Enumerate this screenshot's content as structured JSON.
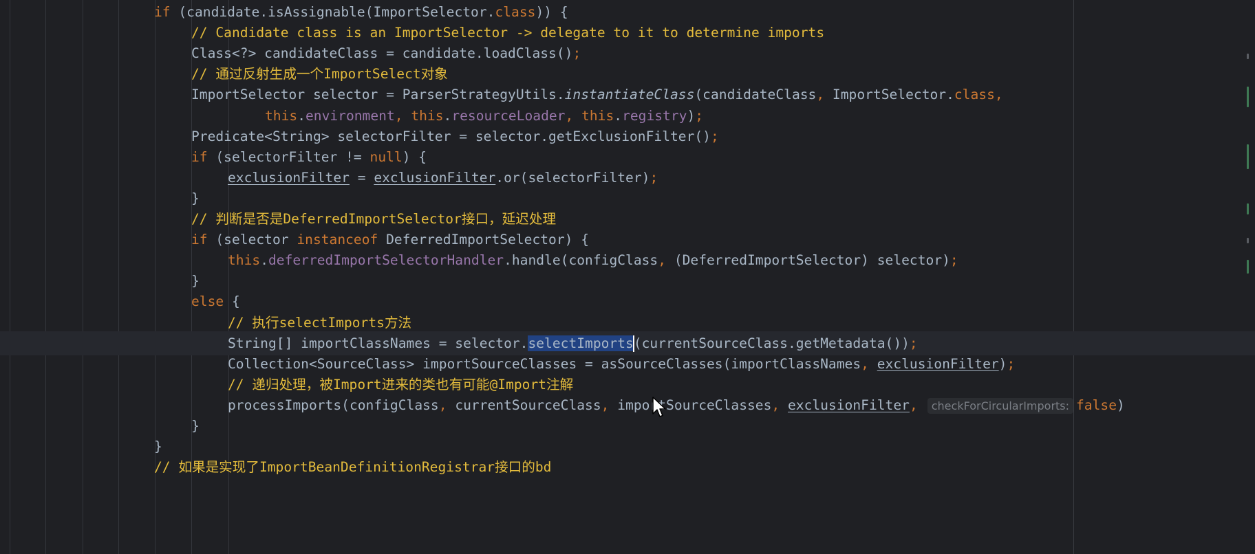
{
  "editor": {
    "lines": [
      {
        "segments": [
          {
            "t": "if",
            "c": "kw"
          },
          {
            "t": " (candidate.isAssignable(ImportSelector."
          },
          {
            "t": "class",
            "c": "kw"
          },
          {
            "t": ")) {"
          }
        ]
      },
      {
        "segments": [
          {
            "t": "// Candidate class is an ImportSelector -> delegate to it to determine imports",
            "c": "cm"
          }
        ]
      },
      {
        "segments": [
          {
            "t": "Class<?> candidateClass = candidate.loadClass()"
          },
          {
            "t": ";",
            "c": "kw"
          }
        ]
      },
      {
        "segments": [
          {
            "t": "// ",
            "c": "cm"
          },
          {
            "t": "通过反射生成一个",
            "c": "cm cjk"
          },
          {
            "t": "ImportSelect",
            "c": "cm bold"
          },
          {
            "t": "对象",
            "c": "cm cjk"
          }
        ]
      },
      {
        "segments": [
          {
            "t": "ImportSelector selector = ParserStrategyUtils."
          },
          {
            "t": "instantiateClass",
            "c": "it"
          },
          {
            "t": "(candidateClass"
          },
          {
            "t": ",",
            "c": "kw"
          },
          {
            "t": " ImportSelector."
          },
          {
            "t": "class",
            "c": "kw"
          },
          {
            "t": ",",
            "c": "kw"
          }
        ]
      },
      {
        "segments": [
          {
            "t": "this",
            "c": "kw"
          },
          {
            "t": "."
          },
          {
            "t": "environment",
            "c": "field"
          },
          {
            "t": ", ",
            "c": "kw"
          },
          {
            "t": "this",
            "c": "kw"
          },
          {
            "t": "."
          },
          {
            "t": "resourceLoader",
            "c": "field"
          },
          {
            "t": ", ",
            "c": "kw"
          },
          {
            "t": "this",
            "c": "kw"
          },
          {
            "t": "."
          },
          {
            "t": "registry",
            "c": "field"
          },
          {
            "t": ")"
          },
          {
            "t": ";",
            "c": "kw"
          }
        ]
      },
      {
        "segments": [
          {
            "t": "Predicate<String> selectorFilter = selector.getExclusionFilter()"
          },
          {
            "t": ";",
            "c": "kw"
          }
        ]
      },
      {
        "segments": [
          {
            "t": "if",
            "c": "kw"
          },
          {
            "t": " (selectorFilter != "
          },
          {
            "t": "null",
            "c": "kw"
          },
          {
            "t": ") {"
          }
        ]
      },
      {
        "segments": [
          {
            "t": "exclusionFilter",
            "c": "ul"
          },
          {
            "t": " = "
          },
          {
            "t": "exclusionFilter",
            "c": "ul"
          },
          {
            "t": ".or(selectorFilter)"
          },
          {
            "t": ";",
            "c": "kw"
          }
        ]
      },
      {
        "segments": [
          {
            "t": "}"
          }
        ]
      },
      {
        "segments": [
          {
            "t": "// ",
            "c": "cm"
          },
          {
            "t": "判断是否是",
            "c": "cm cjk"
          },
          {
            "t": "DeferredImportSelector",
            "c": "cm bold"
          },
          {
            "t": "接口，延迟处理",
            "c": "cm cjk"
          }
        ]
      },
      {
        "segments": [
          {
            "t": "if",
            "c": "kw"
          },
          {
            "t": " (selector "
          },
          {
            "t": "instanceof",
            "c": "kw"
          },
          {
            "t": " DeferredImportSelector) {"
          }
        ]
      },
      {
        "segments": [
          {
            "t": "this",
            "c": "kw"
          },
          {
            "t": "."
          },
          {
            "t": "deferredImportSelectorHandler",
            "c": "field"
          },
          {
            "t": ".handle(configClass"
          },
          {
            "t": ",",
            "c": "kw"
          },
          {
            "t": " (DeferredImportSelector) selector)"
          },
          {
            "t": ";",
            "c": "kw"
          }
        ]
      },
      {
        "segments": [
          {
            "t": "}"
          }
        ]
      },
      {
        "segments": [
          {
            "t": "else",
            "c": "kw"
          },
          {
            "t": " {"
          }
        ]
      },
      {
        "segments": [
          {
            "t": "// ",
            "c": "cm"
          },
          {
            "t": "执行",
            "c": "cm cjk"
          },
          {
            "t": "selectImports",
            "c": "cm bold"
          },
          {
            "t": "方法",
            "c": "cm cjk"
          }
        ]
      },
      {
        "segments": [
          {
            "t": "String[] importClassNames = selector."
          },
          {
            "t": "selectImports",
            "c": "sel"
          },
          {
            "t": "",
            "c": "caret"
          },
          {
            "t": "(currentSourceClass.getMetadata())"
          },
          {
            "t": ";",
            "c": "kw"
          }
        ]
      },
      {
        "segments": [
          {
            "t": "Collection<SourceClass> importSourceClasses = asSourceClasses(importClassNames"
          },
          {
            "t": ", ",
            "c": "kw"
          },
          {
            "t": "exclusionFilter",
            "c": "ul"
          },
          {
            "t": ")"
          },
          {
            "t": ";",
            "c": "kw"
          }
        ]
      },
      {
        "segments": [
          {
            "t": "// ",
            "c": "cm"
          },
          {
            "t": "递归处理，被",
            "c": "cm cjk"
          },
          {
            "t": "Import",
            "c": "cm bold"
          },
          {
            "t": "进来的类也有可能",
            "c": "cm cjk"
          },
          {
            "t": "@Import",
            "c": "cm bold"
          },
          {
            "t": "注解",
            "c": "cm cjk"
          }
        ]
      },
      {
        "segments": [
          {
            "t": "processImports(configClass"
          },
          {
            "t": ", ",
            "c": "kw"
          },
          {
            "t": "currentSourceClass"
          },
          {
            "t": ", ",
            "c": "kw"
          },
          {
            "t": "importSourceClasses"
          },
          {
            "t": ", ",
            "c": "kw"
          },
          {
            "t": "exclusionFilter",
            "c": "ul"
          },
          {
            "t": ",",
            "c": "kw"
          },
          {
            "t": "checkForCircularImports:",
            "c": "hint"
          },
          {
            "t": "false",
            "c": "kw"
          },
          {
            "t": ")"
          }
        ]
      },
      {
        "segments": [
          {
            "t": "}"
          }
        ]
      },
      {
        "segments": [
          {
            "t": "}"
          }
        ]
      },
      {
        "segments": [
          {
            "t": "// ",
            "c": "cm"
          },
          {
            "t": "如果是实现了",
            "c": "cm cjk"
          },
          {
            "t": "ImportBeanDefinitionRegistrar",
            "c": "cm bold"
          },
          {
            "t": "接口的",
            "c": "cm cjk"
          },
          {
            "t": "bd",
            "c": "cm bold"
          }
        ]
      }
    ],
    "current_line_index": 16,
    "highlight_colors": {
      "keyword": "#cc7832",
      "field": "#9876aa",
      "comment": "#e3bb3c",
      "default": "#a9b7c6",
      "selection": "#214283",
      "background": "#1f2024"
    }
  }
}
